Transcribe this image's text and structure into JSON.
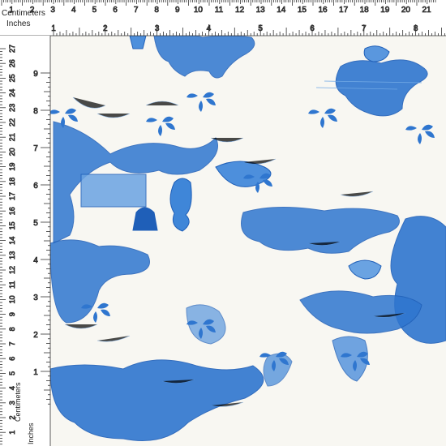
{
  "image": {
    "subject": "blue toile de Jouy fabric print",
    "colors": {
      "background": "#f8f7f2",
      "print_dark": "#1f5fb8",
      "print_mid": "#3f86d8",
      "print_light": "#9cc3ec",
      "ruler": "#ffffff",
      "ruler_ink": "#222222"
    }
  },
  "rulers": {
    "top": {
      "centimeters_label": "Centimeters",
      "inches_label": "Inches",
      "cm_ticks": [
        "1",
        "2",
        "3",
        "4",
        "5",
        "6",
        "7",
        "8",
        "9",
        "10",
        "11",
        "12",
        "13",
        "14",
        "15",
        "16",
        "17",
        "18",
        "19",
        "20",
        "21"
      ],
      "inch_ticks": [
        "1",
        "2",
        "3",
        "4",
        "5",
        "6",
        "7",
        "8"
      ]
    },
    "left": {
      "cm_ticks": [
        "27",
        "26",
        "25",
        "24",
        "23",
        "22",
        "21",
        "20",
        "19",
        "18",
        "17",
        "16",
        "15",
        "14",
        "13",
        "12",
        "11",
        "10",
        "9",
        "8",
        "7",
        "6",
        "5",
        "4",
        "3",
        "2",
        "1"
      ],
      "inch_ticks": [
        "9",
        "8",
        "7",
        "6",
        "5",
        "4",
        "3",
        "2",
        "1"
      ],
      "centimeters_label": "Centimeters",
      "inches_label": "Inches"
    }
  }
}
